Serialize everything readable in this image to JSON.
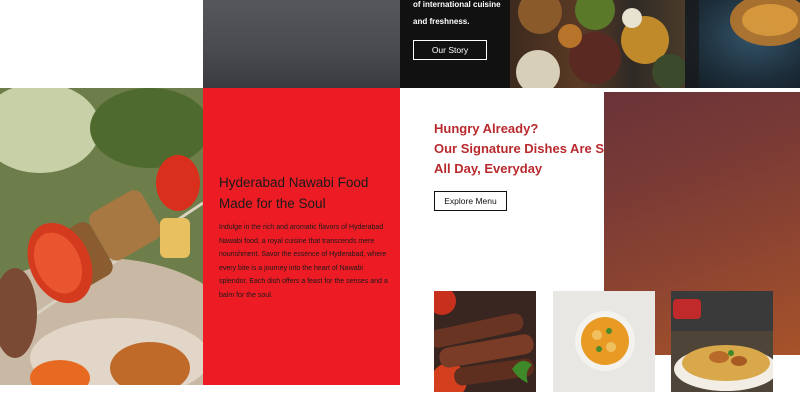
{
  "top": {
    "text": "of international cuisine and freshness.",
    "story_button": "Our Story"
  },
  "about": {
    "title": "Hyderabad Nawabi Food Made for the Soul",
    "body": "Indulge in the rich and aromatic flavors of Hyderabad Nawabi food, a royal cuisine that transcends mere nourishment. Savor the essence of Hyderabad, where every bite is a journey into the heart of Nawabi splendor. Each dish offers a feast for the senses and a balm for the soul."
  },
  "signature": {
    "line1": "Hungry Already?",
    "line2": "Our Signature Dishes Are S",
    "line3": "All Day, Everyday",
    "menu_button": "Explore Menu"
  },
  "colors": {
    "accent_red": "#ed1c24",
    "heading_red": "#b82a2e"
  }
}
